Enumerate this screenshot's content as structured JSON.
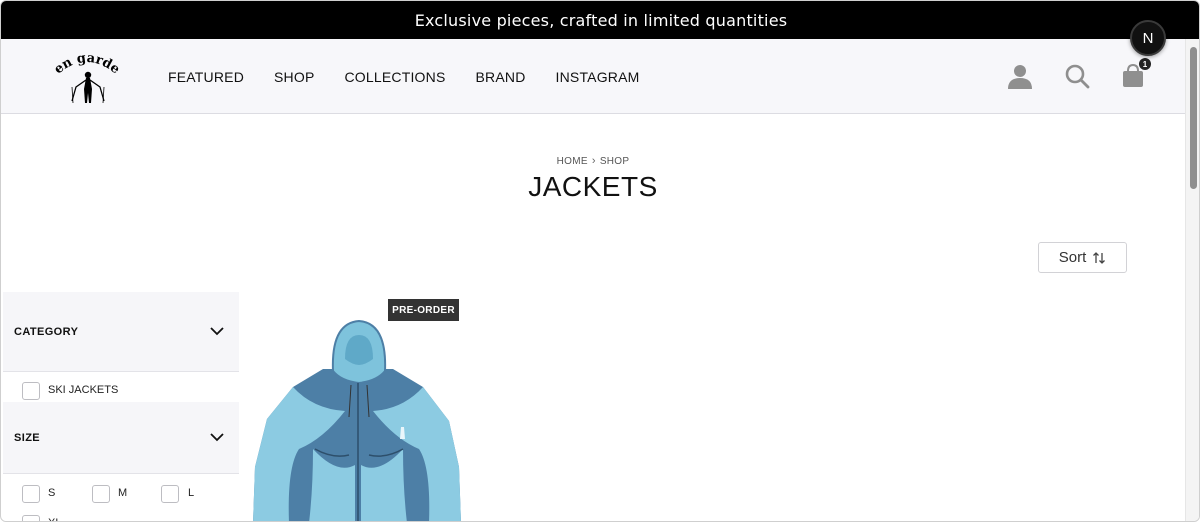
{
  "announcement": {
    "text": "Exclusive pieces, crafted in limited quantities"
  },
  "header": {
    "logo_text": "en garde",
    "nav": [
      {
        "label": "FEATURED"
      },
      {
        "label": "SHOP"
      },
      {
        "label": "COLLECTIONS"
      },
      {
        "label": "BRAND"
      },
      {
        "label": "INSTAGRAM"
      }
    ],
    "icons": [
      "user-icon",
      "search-icon",
      "shopping-bag-icon"
    ],
    "cart_count": "1",
    "dev_badge": "N"
  },
  "breadcrumb": {
    "home": "HOME",
    "current": "SHOP"
  },
  "page": {
    "title": "JACKETS"
  },
  "sort": {
    "label": "Sort"
  },
  "filters": {
    "category": {
      "title": "CATEGORY",
      "options": [
        "SKI JACKETS"
      ]
    },
    "size": {
      "title": "SIZE",
      "options": [
        "S",
        "M",
        "L",
        "XL"
      ]
    }
  },
  "products": [
    {
      "badge": "PRE-ORDER",
      "image": "blue-ski-jacket"
    }
  ],
  "colors": {
    "announcement_bg": "#000000",
    "header_bg": "#f7f7fa",
    "sidebar_bg": "#f6f6f9",
    "badge_bg": "#333333"
  }
}
